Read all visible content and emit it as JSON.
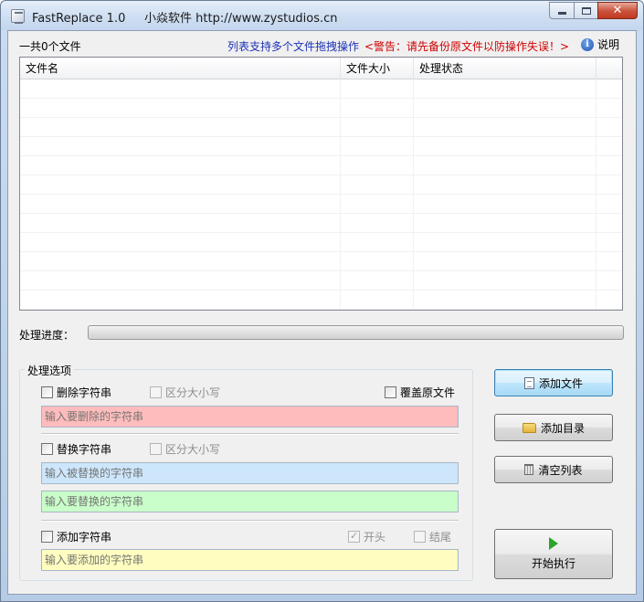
{
  "window": {
    "title": "FastReplace 1.0     小焱软件 http://www.zystudios.cn"
  },
  "header": {
    "file_count": "一共0个文件",
    "drag_tip": "列表支持多个文件拖拽操作",
    "warning": "<警告：请先备份原文件以防操作失误！>",
    "help_label": "说明",
    "help_icon_glyph": "i"
  },
  "list": {
    "columns": [
      "文件名",
      "文件大小",
      "处理状态"
    ],
    "rows": []
  },
  "progress": {
    "label": "处理进度：",
    "value": 0
  },
  "options": {
    "group_title": "处理选项",
    "delete": {
      "label": "删除字符串",
      "checked": false,
      "case_label": "区分大小写",
      "placeholder": "输入要删除的字符串"
    },
    "overwrite": {
      "label": "覆盖原文件",
      "checked": false
    },
    "replace": {
      "label": "替换字符串",
      "checked": false,
      "case_label": "区分大小写",
      "find_placeholder": "输入被替换的字符串",
      "replace_placeholder": "输入要替换的字符串"
    },
    "add": {
      "label": "添加字符串",
      "checked": false,
      "start_label": "开头",
      "start_checked": true,
      "end_label": "结尾",
      "end_checked": false,
      "placeholder": "输入要添加的字符串"
    }
  },
  "buttons": {
    "add_file": "添加文件",
    "add_dir": "添加目录",
    "clear_list": "清空列表",
    "start": "开始执行"
  },
  "colors": {
    "delete_field": "#ffbcbc",
    "find_field": "#cde6fc",
    "replace_field": "#c9fdc9",
    "add_field": "#fffdbf",
    "warning_text": "#d10000",
    "tip_text": "#1c32b4"
  }
}
